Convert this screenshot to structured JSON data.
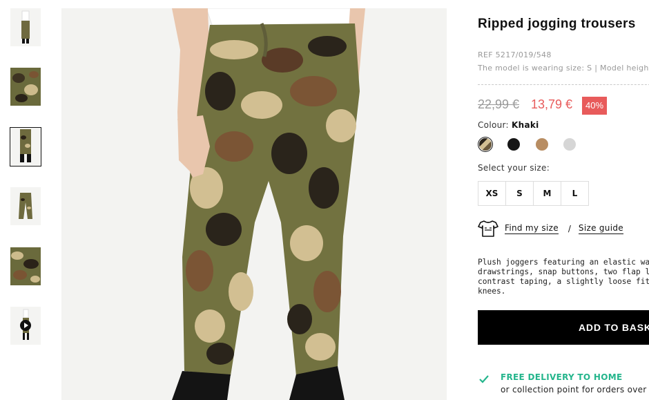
{
  "thumbnails": [
    {
      "name": "thumb-1",
      "selected": false,
      "video": false
    },
    {
      "name": "thumb-2",
      "selected": false,
      "video": false
    },
    {
      "name": "thumb-3",
      "selected": true,
      "video": false
    },
    {
      "name": "thumb-4",
      "selected": false,
      "video": false
    },
    {
      "name": "thumb-5",
      "selected": false,
      "video": false
    },
    {
      "name": "thumb-6",
      "selected": false,
      "video": true
    }
  ],
  "product": {
    "title": "Ripped jogging trousers",
    "ref": "REF 5217/019/548",
    "model_info": "The model is wearing size: S | Model height:",
    "old_price": "22,99 €",
    "new_price": "13,79 €",
    "discount": "40%",
    "colour_label": "Colour:",
    "colour_value": "Khaki",
    "swatches": [
      {
        "name": "khaki",
        "color": "#6b5a3c",
        "selected": true
      },
      {
        "name": "black",
        "color": "#161616",
        "selected": false
      },
      {
        "name": "beige",
        "color": "#b88d62",
        "selected": false
      },
      {
        "name": "grey",
        "color": "#d6d6d6",
        "selected": false
      }
    ],
    "size_label": "Select your size:",
    "sizes": [
      "XS",
      "S",
      "M",
      "L"
    ],
    "find_size": "Find my size",
    "separator": "/",
    "size_guide": "Size guide",
    "description_lines": [
      "Plush joggers featuring an elastic waistband",
      "drawstrings, snap buttons, two flap leg pockets",
      "contrast taping, a slightly loose fit, elastication",
      "knees."
    ],
    "add_button": "ADD TO BASKET",
    "delivery_title": "FREE DELIVERY TO HOME",
    "delivery_sub": "or collection point for orders over €"
  },
  "colors": {
    "accent_red": "#e85b5b",
    "delivery_green": "#24b58c"
  }
}
